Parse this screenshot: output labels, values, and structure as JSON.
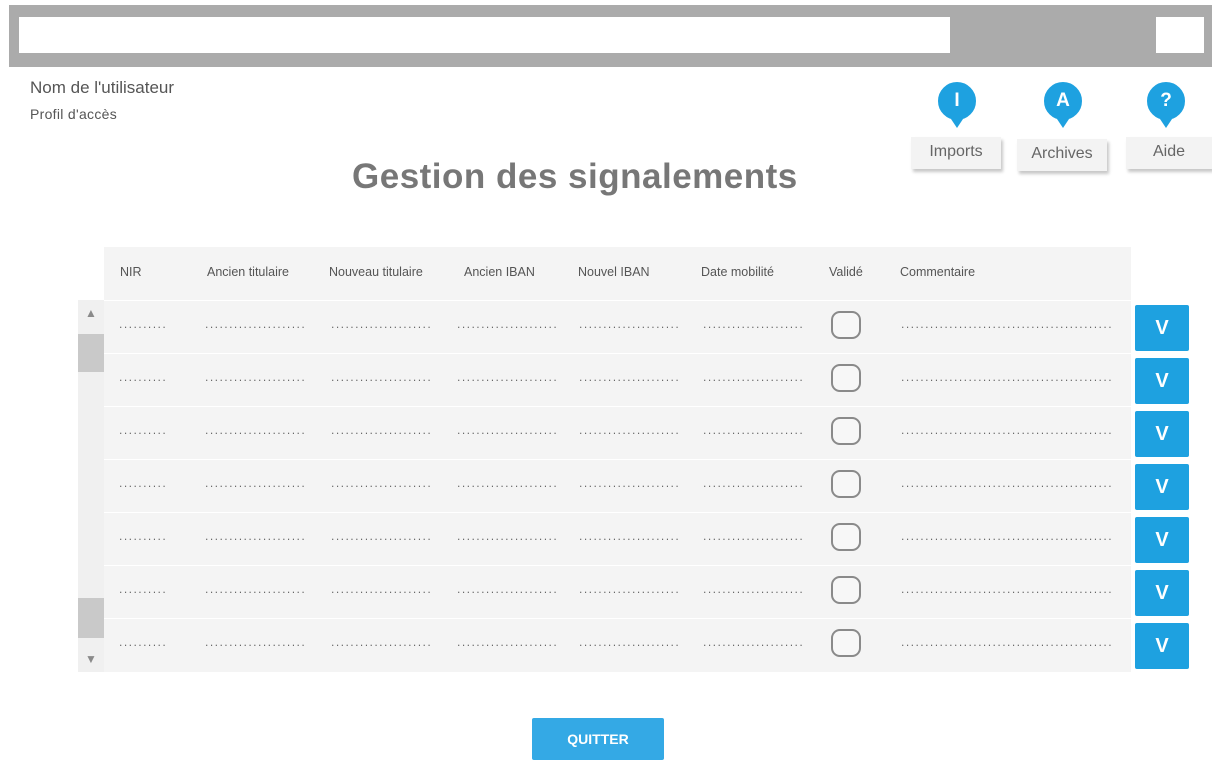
{
  "header": {
    "address_value": "",
    "user_name": "Nom de l'utilisateur",
    "user_profile": "Profil d'accès"
  },
  "nav": [
    {
      "badge": "I",
      "label": "Imports",
      "icon": "imports-icon"
    },
    {
      "badge": "A",
      "label": "Archives",
      "icon": "archives-icon"
    },
    {
      "badge": "?",
      "label": "Aide",
      "icon": "help-icon"
    }
  ],
  "page_title": "Gestion des signalements",
  "table": {
    "columns": [
      "NIR",
      "Ancien titulaire",
      "Nouveau titulaire",
      "Ancien IBAN",
      "Nouvel IBAN",
      "Date mobilité",
      "Validé",
      "Commentaire"
    ],
    "rows": [
      {
        "nir": "..........",
        "ancien_titulaire": ".....................",
        "nouveau_titulaire": ".....................",
        "ancien_iban": ".....................",
        "nouvel_iban": ".....................",
        "date_mobilite": ".....................",
        "valide": false,
        "commentaire": "..............................................",
        "validate_label": "V"
      },
      {
        "nir": "..........",
        "ancien_titulaire": ".....................",
        "nouveau_titulaire": ".....................",
        "ancien_iban": ".....................",
        "nouvel_iban": ".....................",
        "date_mobilite": ".....................",
        "valide": false,
        "commentaire": "..............................................",
        "validate_label": "V"
      },
      {
        "nir": "..........",
        "ancien_titulaire": ".....................",
        "nouveau_titulaire": ".....................",
        "ancien_iban": ".....................",
        "nouvel_iban": ".....................",
        "date_mobilite": ".....................",
        "valide": false,
        "commentaire": "..............................................",
        "validate_label": "V"
      },
      {
        "nir": "..........",
        "ancien_titulaire": ".....................",
        "nouveau_titulaire": ".....................",
        "ancien_iban": ".....................",
        "nouvel_iban": ".....................",
        "date_mobilite": ".....................",
        "valide": false,
        "commentaire": "..............................................",
        "validate_label": "V"
      },
      {
        "nir": "..........",
        "ancien_titulaire": ".....................",
        "nouveau_titulaire": ".....................",
        "ancien_iban": ".....................",
        "nouvel_iban": ".....................",
        "date_mobilite": ".....................",
        "valide": false,
        "commentaire": "..............................................",
        "validate_label": "V"
      },
      {
        "nir": "..........",
        "ancien_titulaire": ".....................",
        "nouveau_titulaire": ".....................",
        "ancien_iban": ".....................",
        "nouvel_iban": ".....................",
        "date_mobilite": ".....................",
        "valide": false,
        "commentaire": "..............................................",
        "validate_label": "V"
      },
      {
        "nir": "..........",
        "ancien_titulaire": ".....................",
        "nouveau_titulaire": ".....................",
        "ancien_iban": ".....................",
        "nouvel_iban": ".....................",
        "date_mobilite": ".....................",
        "valide": false,
        "commentaire": "..............................................",
        "validate_label": "V"
      }
    ]
  },
  "scrollbar": {
    "up_icon": "▲",
    "down_icon": "▼"
  },
  "quit_label": "QUITTER",
  "colors": {
    "accent": "#1ea1e0",
    "topbar": "#ababab",
    "table_bg": "#f4f4f4"
  }
}
